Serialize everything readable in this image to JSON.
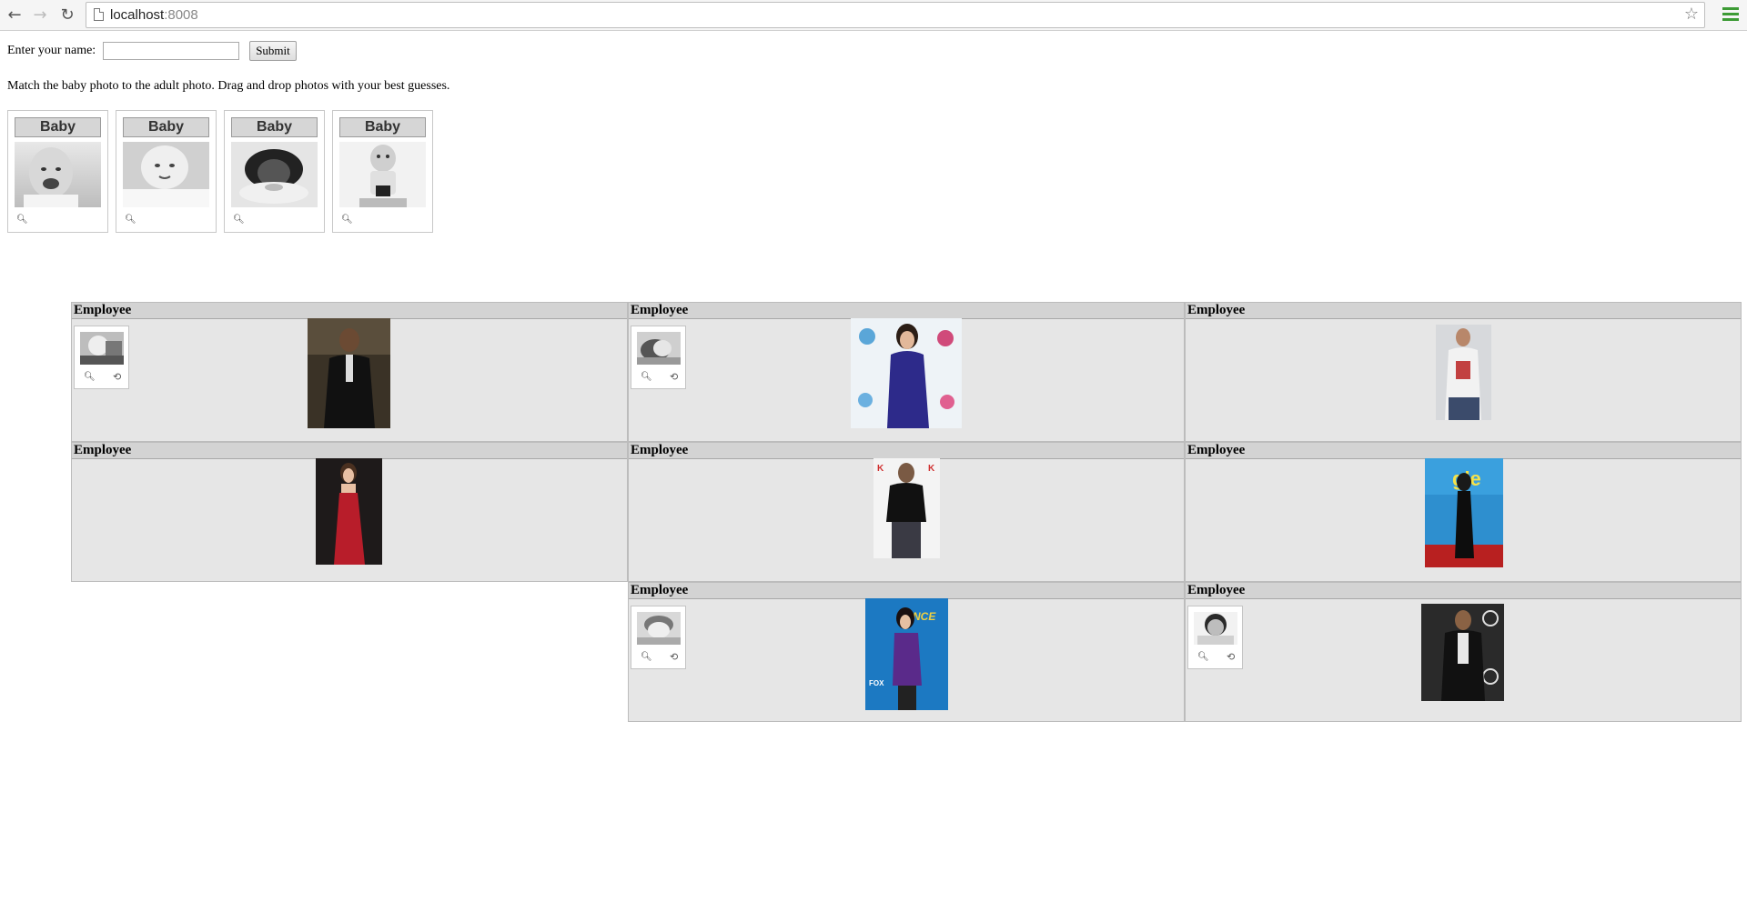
{
  "browser": {
    "url_host": "localhost",
    "url_port": ":8008",
    "icons": {
      "back": "back-arrow-icon",
      "forward": "forward-arrow-icon",
      "reload": "reload-icon",
      "bookmark": "star-icon",
      "menu": "hamburger-menu-icon"
    }
  },
  "form": {
    "name_label": "Enter your name:",
    "name_value": "",
    "submit_label": "Submit"
  },
  "instructions": "Match the baby photo to the adult photo. Drag and drop photos with your best guesses.",
  "baby_cards": [
    {
      "label": "Baby"
    },
    {
      "label": "Baby"
    },
    {
      "label": "Baby"
    },
    {
      "label": "Baby"
    }
  ],
  "employees": [
    {
      "label": "Employee",
      "has_baby": true
    },
    {
      "label": "Employee",
      "has_baby": true
    },
    {
      "label": "Employee",
      "has_baby": false
    },
    {
      "label": "Employee",
      "has_baby": false
    },
    {
      "label": "Employee",
      "has_baby": false
    },
    {
      "label": "Employee",
      "has_baby": false
    },
    {
      "label": "Employee",
      "has_baby": true
    },
    {
      "label": "Employee",
      "has_baby": true
    }
  ]
}
